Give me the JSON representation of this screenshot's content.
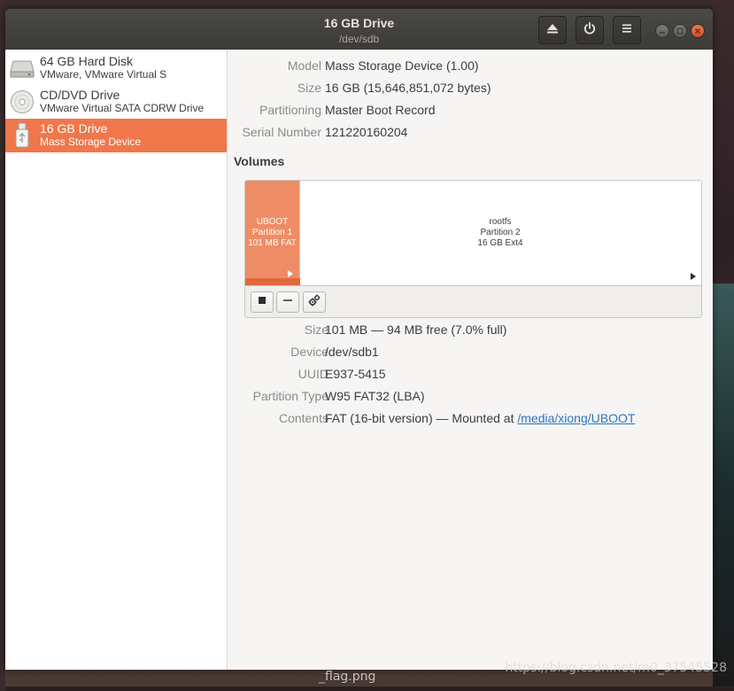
{
  "window": {
    "title": "16 GB Drive",
    "subtitle": "/dev/sdb"
  },
  "toolbar": {
    "eject_icon": "eject-icon",
    "power_icon": "power-icon",
    "menu_icon": "hamburger-menu-icon"
  },
  "sidebar": {
    "items": [
      {
        "name": "64 GB Hard Disk",
        "desc": "VMware, VMware Virtual S",
        "icon": "hard-disk-icon",
        "selected": false
      },
      {
        "name": "CD/DVD Drive",
        "desc": "VMware Virtual SATA CDRW Drive",
        "icon": "optical-disc-icon",
        "selected": false
      },
      {
        "name": "16 GB Drive",
        "desc": "Mass Storage Device",
        "icon": "usb-drive-icon",
        "selected": true
      }
    ]
  },
  "drive_info": {
    "model_label": "Model",
    "model_value": "Mass Storage Device (1.00)",
    "size_label": "Size",
    "size_value": "16 GB (15,646,851,072 bytes)",
    "partitioning_label": "Partitioning",
    "partitioning_value": "Master Boot Record",
    "serial_label": "Serial Number",
    "serial_value": "121220160204"
  },
  "volumes": {
    "title": "Volumes",
    "partitions": [
      {
        "line1": "UBOOT",
        "line2": "Partition 1",
        "line3": "101 MB FAT",
        "selected": true
      },
      {
        "line1": "rootfs",
        "line2": "Partition 2",
        "line3": "16 GB Ext4",
        "selected": false
      }
    ]
  },
  "volume_info": {
    "size_label": "Size",
    "size_value": "101 MB — 94 MB free (7.0% full)",
    "device_label": "Device",
    "device_value": "/dev/sdb1",
    "uuid_label": "UUID",
    "uuid_value": "E937-5415",
    "ptype_label": "Partition Type",
    "ptype_value": "W95 FAT32 (LBA)",
    "contents_label": "Contents",
    "contents_prefix": "FAT (16-bit version) — Mounted at ",
    "contents_link": "/media/xiong/UBOOT"
  },
  "desktop": {
    "caption": "_flag.png",
    "watermark": "https://blog.csdn.net/m0_37545528"
  },
  "colors": {
    "accent": "#f0774a",
    "titlebar": "#3c3b37",
    "link": "#2a76c6"
  }
}
